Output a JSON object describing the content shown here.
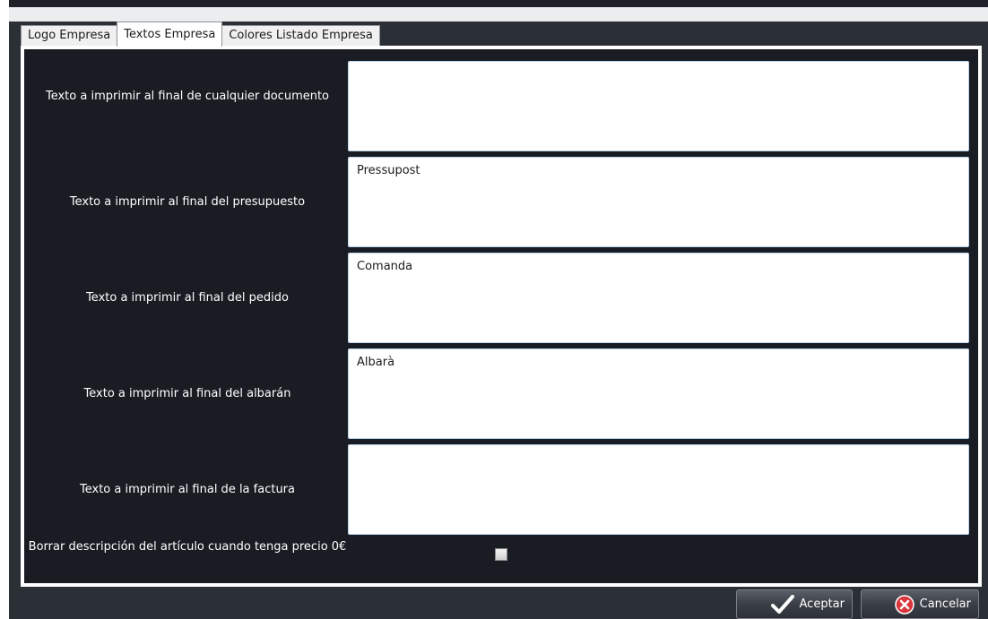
{
  "tabs": [
    {
      "label": "Logo Empresa",
      "active": false
    },
    {
      "label": "Textos Empresa",
      "active": true
    },
    {
      "label": "Colores Listado Empresa",
      "active": false
    }
  ],
  "fields": [
    {
      "label": "Texto a imprimir al final de cualquier documento",
      "value": ""
    },
    {
      "label": "Texto a imprimir al final del presupuesto",
      "value": "Pressupost"
    },
    {
      "label": "Texto a imprimir al final del pedido",
      "value": "Comanda"
    },
    {
      "label": "Texto a imprimir al final del albarán",
      "value": "Albarà"
    },
    {
      "label": "Texto a imprimir al final de la factura",
      "value": ""
    }
  ],
  "checkbox": {
    "label": "Borrar descripción del artículo cuando tenga precio 0€",
    "checked": false
  },
  "buttons": {
    "accept": "Aceptar",
    "cancel": "Cancelar"
  },
  "icons": {
    "accept": "checkmark-icon",
    "cancel": "close-circle-icon"
  },
  "colors": {
    "background": "#1a1c24",
    "cancel_icon": "#d9363e"
  }
}
